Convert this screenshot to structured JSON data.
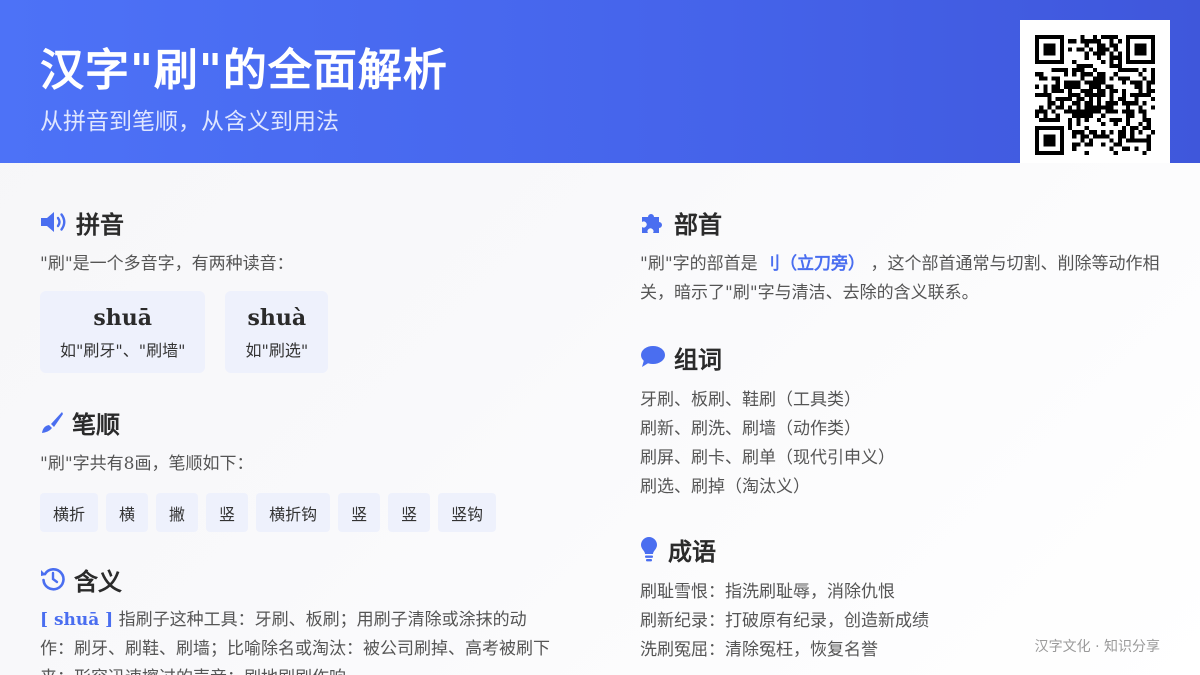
{
  "header": {
    "title": "汉字\"刷\"的全面解析",
    "subtitle": "从拼音到笔顺，从含义到用法"
  },
  "pinyin": {
    "title": "拼音",
    "icon": "speaker-icon",
    "intro": "\"刷\"是一个多音字，有两种读音：",
    "readings": [
      {
        "pinyin": "shuā",
        "example": "如\"刷牙\"、\"刷墙\""
      },
      {
        "pinyin": "shuà",
        "example": "如\"刷选\""
      }
    ]
  },
  "strokes": {
    "title": "笔顺",
    "icon": "brush-icon",
    "intro": "\"刷\"字共有8画，笔顺如下：",
    "items": [
      "横折",
      "横",
      "撇",
      "竖",
      "横折钩",
      "竖",
      "竖",
      "竖钩"
    ]
  },
  "meaning": {
    "title": "含义",
    "icon": "history-icon",
    "tag": "[ shuā ]",
    "text": "指刷子这种工具：牙刷、板刷；用刷子清除或涂抹的动作：刷牙、刷鞋、刷墙；比喻除名或淘汰：被公司刷掉、高考被刷下来；形容迅速擦过的声音：刷地刷刷作响。"
  },
  "radical": {
    "title": "部首",
    "icon": "puzzle-icon",
    "pre": "\"刷\"字的部首是",
    "highlight": "刂（立刀旁）",
    "post": "，这个部首通常与切割、削除等动作相关，暗示了\"刷\"字与清洁、去除的含义联系。"
  },
  "words": {
    "title": "组词",
    "icon": "chat-bubble-icon",
    "lines": [
      "牙刷、板刷、鞋刷（工具类）",
      "刷新、刷洗、刷墙（动作类）",
      "刷屏、刷卡、刷单（现代引申义）",
      "刷选、刷掉（淘汰义）"
    ]
  },
  "idioms": {
    "title": "成语",
    "icon": "lightbulb-icon",
    "lines": [
      "刷耻雪恨：指洗刷耻辱，消除仇恨",
      "刷新纪录：打破原有纪录，创造新成绩",
      "洗刷冤屈：清除冤枉，恢复名誉"
    ]
  },
  "footer": "汉字文化 · 知识分享",
  "colors": {
    "accent": "#4a6ef0",
    "header_start": "#4d72f7",
    "header_end": "#3f57db"
  }
}
